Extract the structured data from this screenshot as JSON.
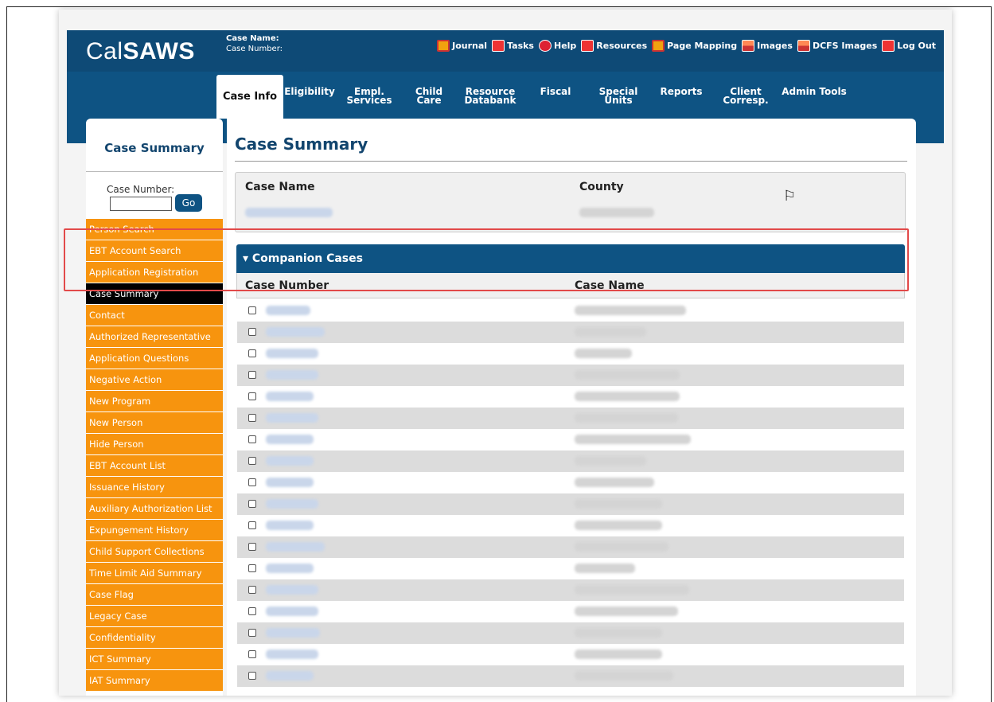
{
  "app": {
    "logo_light": "Cal",
    "logo_bold": "SAWS",
    "case_name_label": "Case Name:",
    "case_number_label": "Case Number:"
  },
  "toplinks": [
    {
      "label": "Journal",
      "icon": "book-icon"
    },
    {
      "label": "Tasks",
      "icon": "check-icon"
    },
    {
      "label": "Help",
      "icon": "question-icon"
    },
    {
      "label": "Resources",
      "icon": "list-icon"
    },
    {
      "label": "Page Mapping",
      "icon": "map-book-icon"
    },
    {
      "label": "Images",
      "icon": "image-icon"
    },
    {
      "label": "DCFS Images",
      "icon": "image-icon"
    },
    {
      "label": "Log Out",
      "icon": "logout-icon"
    }
  ],
  "tabs": [
    {
      "label": "Case Info"
    },
    {
      "label": "Eligibility"
    },
    {
      "label": "Empl.\nServices"
    },
    {
      "label": "Child Care"
    },
    {
      "label": "Resource\nDatabank"
    },
    {
      "label": "Fiscal"
    },
    {
      "label": "Special\nUnits"
    },
    {
      "label": "Reports"
    },
    {
      "label": "Client\nCorresp."
    },
    {
      "label": "Admin Tools"
    }
  ],
  "left": {
    "title": "Case Summary",
    "case_number_label": "Case Number:",
    "go_label": "Go",
    "menu": [
      "Person Search",
      "EBT Account Search",
      "Application Registration",
      "Case Summary",
      "Contact",
      "Authorized Representative",
      "Application Questions",
      "Negative Action",
      "New Program",
      "New Person",
      "Hide Person",
      "EBT Account List",
      "Issuance History",
      "Auxiliary Authorization List",
      "Expungement History",
      "Child Support Collections",
      "Time Limit Aid Summary",
      "Case Flag",
      "Legacy Case",
      "Confidentiality",
      "ICT Summary",
      "IAT Summary"
    ]
  },
  "main": {
    "title": "Case Summary",
    "case_name_header": "Case Name",
    "county_header": "County",
    "flag_icon": "flag-icon",
    "companion_header": "Companion Cases",
    "col_case_number": "Case Number",
    "col_case_name": "Case Name"
  },
  "colors": {
    "nav_blue": "#0e5383",
    "menu_orange": "#f7940e",
    "title_blue": "#12456e",
    "highlight_red": "#e24a4a"
  }
}
